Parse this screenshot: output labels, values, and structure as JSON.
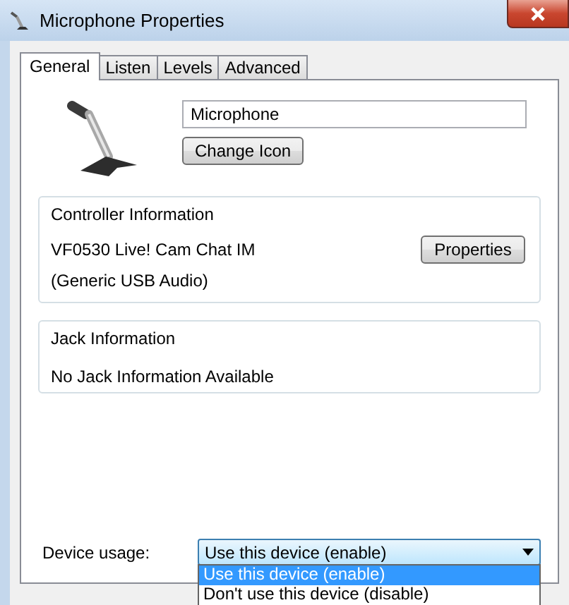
{
  "window": {
    "title": "Microphone Properties"
  },
  "tabs": [
    {
      "label": "General",
      "selected": true
    },
    {
      "label": "Listen",
      "selected": false
    },
    {
      "label": "Levels",
      "selected": false
    },
    {
      "label": "Advanced",
      "selected": false
    }
  ],
  "name_field": {
    "value": "Microphone"
  },
  "change_icon_button": "Change Icon",
  "controller_information": {
    "title": "Controller Information",
    "device": "VF0530 Live! Cam Chat IM",
    "driver": "(Generic USB Audio)",
    "button": "Properties"
  },
  "jack_information": {
    "title": "Jack Information",
    "text": "No Jack Information Available"
  },
  "device_usage": {
    "label": "Device usage:",
    "value": "Use this device (enable)",
    "expanded": true,
    "options": [
      {
        "label": "Use this device (enable)",
        "selected": true
      },
      {
        "label": "Don't use this device (disable)",
        "selected": false
      }
    ]
  }
}
